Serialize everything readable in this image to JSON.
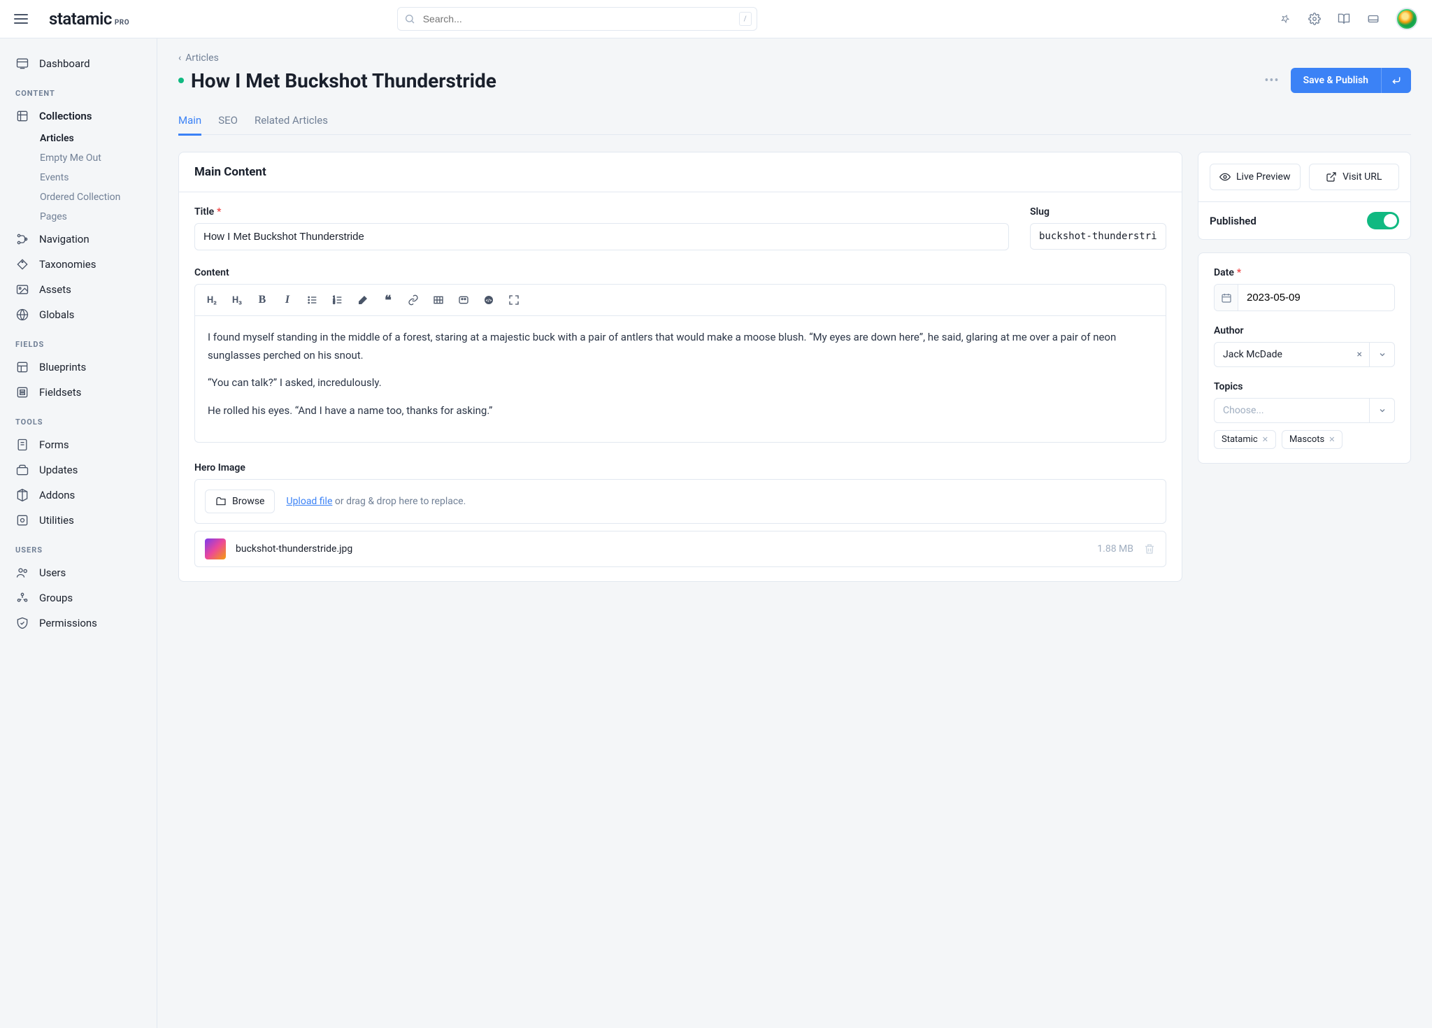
{
  "logo": {
    "text": "statamic",
    "pro": "PRO"
  },
  "search": {
    "placeholder": "Search...",
    "kbd": "/"
  },
  "sidebar": {
    "dashboard": "Dashboard",
    "headings": {
      "content": "CONTENT",
      "fields": "FIELDS",
      "tools": "TOOLS",
      "users": "USERS"
    },
    "items": {
      "collections": "Collections",
      "articles": "Articles",
      "emptyme": "Empty Me Out",
      "events": "Events",
      "ordered": "Ordered Collection",
      "pages": "Pages",
      "navigation": "Navigation",
      "taxonomies": "Taxonomies",
      "assets": "Assets",
      "globals": "Globals",
      "blueprints": "Blueprints",
      "fieldsets": "Fieldsets",
      "forms": "Forms",
      "updates": "Updates",
      "addons": "Addons",
      "utilities": "Utilities",
      "users": "Users",
      "groups": "Groups",
      "permissions": "Permissions"
    }
  },
  "breadcrumb": {
    "parent": "Articles"
  },
  "page": {
    "title": "How I Met Buckshot Thunderstride"
  },
  "actions": {
    "save": "Save & Publish"
  },
  "tabs": {
    "main": "Main",
    "seo": "SEO",
    "related": "Related Articles"
  },
  "mainContent": {
    "heading": "Main Content",
    "titleLabel": "Title",
    "titleValue": "How I Met Buckshot Thunderstride",
    "slugLabel": "Slug",
    "slugValue": "buckshot-thunderstride",
    "contentLabel": "Content",
    "p1": "I found myself standing in the middle of a forest, staring at a majestic buck with a pair of antlers that would make a moose blush. “My eyes are down here”, he said, glaring at me over a pair of neon sunglasses perched on his snout.",
    "p2": "“You can talk?” I asked, incredulously.",
    "p3": "He rolled his eyes. “And I have a name too, thanks for asking.”",
    "heroLabel": "Hero Image",
    "browse": "Browse",
    "uploadLink": "Upload file",
    "uploadHint": " or drag & drop here to replace.",
    "fileName": "buckshot-thunderstride.jpg",
    "fileSize": "1.88 MB"
  },
  "sidepanel": {
    "livePreview": "Live Preview",
    "visitUrl": "Visit URL",
    "published": "Published",
    "dateLabel": "Date",
    "dateValue": "2023-05-09",
    "authorLabel": "Author",
    "authorValue": "Jack McDade",
    "topicsLabel": "Topics",
    "topicsPlaceholder": "Choose...",
    "tags": [
      "Statamic",
      "Mascots"
    ]
  },
  "editorTools": {
    "h2": "H₂",
    "h3": "H₃",
    "bold": "B",
    "italic": "I"
  }
}
